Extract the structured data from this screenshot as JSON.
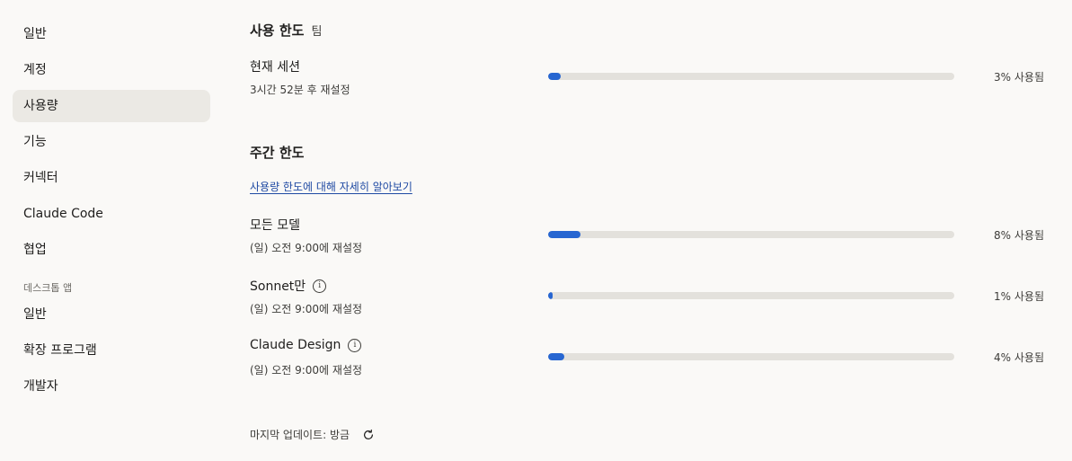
{
  "sidebar": {
    "items": [
      {
        "label": "일반"
      },
      {
        "label": "계정"
      },
      {
        "label": "사용량"
      },
      {
        "label": "기능"
      },
      {
        "label": "커넥터"
      },
      {
        "label": "Claude Code"
      },
      {
        "label": "협업"
      }
    ],
    "desktop_section_label": "데스크톱 앱",
    "desktop_items": [
      {
        "label": "일반"
      },
      {
        "label": "확장 프로그램"
      },
      {
        "label": "개발자"
      }
    ],
    "active_index": 2
  },
  "usage": {
    "title": "사용 한도",
    "plan_tag": "팀",
    "current_session": {
      "label": "현재 세션",
      "reset": "3시간 52분 후 재설정",
      "percent": 3,
      "percent_label": "3% 사용됨"
    }
  },
  "weekly": {
    "title": "주간 한도",
    "learn_more_link": "사용량 한도에 대해 자세히 알아보기",
    "rows": [
      {
        "label": "모든 모델",
        "reset": "(일) 오전 9:00에 재설정",
        "percent": 8,
        "percent_label": "8% 사용됨",
        "has_info": false
      },
      {
        "label": "Sonnet만",
        "reset": "(일) 오전 9:00에 재설정",
        "percent": 1,
        "percent_label": "1% 사용됨",
        "has_info": true
      },
      {
        "label": "Claude Design",
        "reset": "(일) 오전 9:00에 재설정",
        "percent": 4,
        "percent_label": "4% 사용됨",
        "has_info": true
      }
    ]
  },
  "footer": {
    "last_updated": "마지막 업데이트: 방금"
  },
  "colors": {
    "accent": "#2766d1",
    "track": "#e3e1dc",
    "active_nav_bg": "#ebe9e4",
    "background": "#faf9f7"
  },
  "icons": {
    "info": "info-circle-icon",
    "refresh": "refresh-icon"
  }
}
